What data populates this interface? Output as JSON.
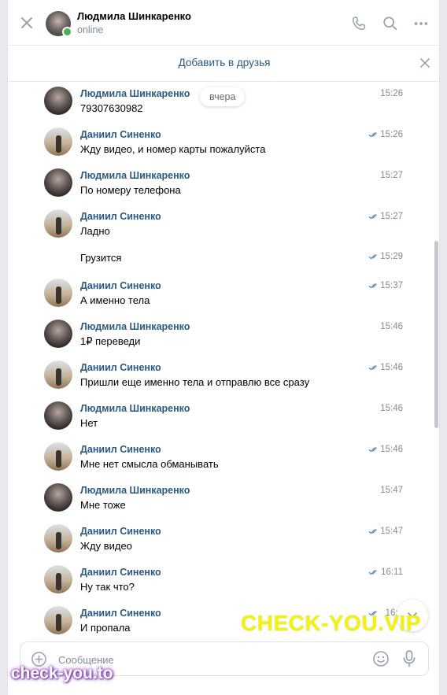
{
  "header": {
    "peer_name": "Людмила Шинкаренко",
    "peer_status": "online",
    "icons": [
      "close-icon",
      "phone-icon",
      "search-icon",
      "more-icon"
    ]
  },
  "friend_bar": {
    "label": "Добавить в друзья"
  },
  "date_separator": "вчера",
  "messages": [
    {
      "author": "Людмила Шинкаренко",
      "text": "79307630982",
      "time": "15:26",
      "read": false
    },
    {
      "author": "Даниил Синенко",
      "text": "Жду видео, и номер карты пожалуйста",
      "time": "15:26",
      "read": true
    },
    {
      "author": "Людмила Шинкаренко",
      "text": "По номеру телефона",
      "time": "15:27",
      "read": false
    },
    {
      "author": "Даниил Синенко",
      "text": "Ладно",
      "time": "15:27",
      "read": true
    },
    {
      "author": "",
      "text": "Грузится",
      "time": "15:29",
      "read": true
    },
    {
      "author": "Даниил Синенко",
      "text": "А именно тела",
      "time": "15:37",
      "read": true
    },
    {
      "author": "Людмила Шинкаренко",
      "text": "1₽ переведи",
      "time": "15:46",
      "read": false
    },
    {
      "author": "Даниил Синенко",
      "text": "Пришли еще именно тела и отправлю все сразу",
      "time": "15:46",
      "read": true
    },
    {
      "author": "Людмила Шинкаренко",
      "text": "Нет",
      "time": "15:46",
      "read": false
    },
    {
      "author": "Даниил Синенко",
      "text": "Мне нет смысла обманывать",
      "time": "15:46",
      "read": true
    },
    {
      "author": "Людмила Шинкаренко",
      "text": "Мне тоже",
      "time": "15:47",
      "read": false
    },
    {
      "author": "Даниил Синенко",
      "text": "Жду видео",
      "time": "15:47",
      "read": true
    },
    {
      "author": "Даниил Синенко",
      "text": "Ну так что?",
      "time": "16:11",
      "read": true
    },
    {
      "author": "Даниил Синенко",
      "text": "И пропала",
      "time": "16:2",
      "read": true
    }
  ],
  "composer": {
    "placeholder": "Сообщение"
  },
  "watermarks": {
    "main": "CHECK-YOU.VIP",
    "corner": "check-you.to"
  },
  "colors": {
    "link": "#2a5885",
    "online": "#4bb34b",
    "read_tick": "#5181b8",
    "watermark_main": "#f2f20f"
  }
}
